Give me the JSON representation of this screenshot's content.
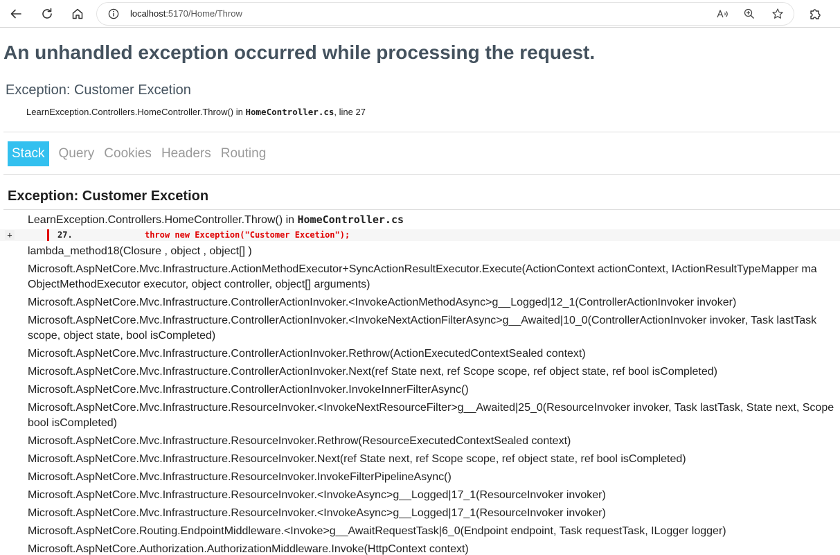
{
  "browser": {
    "url_host": "localhost",
    "url_path": ":5170/Home/Throw"
  },
  "page": {
    "title": "An unhandled exception occurred while processing the request.",
    "error_title": "Exception: Customer Excetion",
    "location_prefix": "LearnException.Controllers.HomeController.Throw() in ",
    "location_file": "HomeController.cs",
    "location_suffix": ", line 27"
  },
  "tabs": [
    {
      "label": "Stack",
      "selected": true
    },
    {
      "label": "Query",
      "selected": false
    },
    {
      "label": "Cookies",
      "selected": false
    },
    {
      "label": "Headers",
      "selected": false
    },
    {
      "label": "Routing",
      "selected": false
    }
  ],
  "stack": {
    "title": "Exception: Customer Excetion",
    "first_frame_prefix": "LearnException.Controllers.HomeController.Throw() in ",
    "first_frame_file": "HomeController.cs",
    "code": {
      "expander": "+",
      "line_no": "27.",
      "text": "throw new Exception(\"Customer Excetion\");"
    },
    "frames": [
      {
        "line1": "lambda_method18(Closure , object , object[] )"
      },
      {
        "line1": "Microsoft.AspNetCore.Mvc.Infrastructure.ActionMethodExecutor+SyncActionResultExecutor.Execute(ActionContext actionContext, IActionResultTypeMapper ma",
        "line2": "ObjectMethodExecutor executor, object controller, object[] arguments)"
      },
      {
        "line1": "Microsoft.AspNetCore.Mvc.Infrastructure.ControllerActionInvoker.<InvokeActionMethodAsync>g__Logged|12_1(ControllerActionInvoker invoker)"
      },
      {
        "line1": "Microsoft.AspNetCore.Mvc.Infrastructure.ControllerActionInvoker.<InvokeNextActionFilterAsync>g__Awaited|10_0(ControllerActionInvoker invoker, Task lastTask",
        "line2": "scope, object state, bool isCompleted)"
      },
      {
        "line1": "Microsoft.AspNetCore.Mvc.Infrastructure.ControllerActionInvoker.Rethrow(ActionExecutedContextSealed context)"
      },
      {
        "line1": "Microsoft.AspNetCore.Mvc.Infrastructure.ControllerActionInvoker.Next(ref State next, ref Scope scope, ref object state, ref bool isCompleted)"
      },
      {
        "line1": "Microsoft.AspNetCore.Mvc.Infrastructure.ControllerActionInvoker.InvokeInnerFilterAsync()"
      },
      {
        "line1": "Microsoft.AspNetCore.Mvc.Infrastructure.ResourceInvoker.<InvokeNextResourceFilter>g__Awaited|25_0(ResourceInvoker invoker, Task lastTask, State next, Scope",
        "line2": "bool isCompleted)"
      },
      {
        "line1": "Microsoft.AspNetCore.Mvc.Infrastructure.ResourceInvoker.Rethrow(ResourceExecutedContextSealed context)"
      },
      {
        "line1": "Microsoft.AspNetCore.Mvc.Infrastructure.ResourceInvoker.Next(ref State next, ref Scope scope, ref object state, ref bool isCompleted)"
      },
      {
        "line1": "Microsoft.AspNetCore.Mvc.Infrastructure.ResourceInvoker.InvokeFilterPipelineAsync()"
      },
      {
        "line1": "Microsoft.AspNetCore.Mvc.Infrastructure.ResourceInvoker.<InvokeAsync>g__Logged|17_1(ResourceInvoker invoker)"
      },
      {
        "line1": "Microsoft.AspNetCore.Mvc.Infrastructure.ResourceInvoker.<InvokeAsync>g__Logged|17_1(ResourceInvoker invoker)"
      },
      {
        "line1": "Microsoft.AspNetCore.Routing.EndpointMiddleware.<Invoke>g__AwaitRequestTask|6_0(Endpoint endpoint, Task requestTask, ILogger logger)"
      },
      {
        "line1": "Microsoft.AspNetCore.Authorization.AuthorizationMiddleware.Invoke(HttpContext context)"
      }
    ]
  },
  "colors": {
    "accent_tab": "#33c0ef",
    "error_code": "#e00000",
    "heading": "#44525e"
  }
}
